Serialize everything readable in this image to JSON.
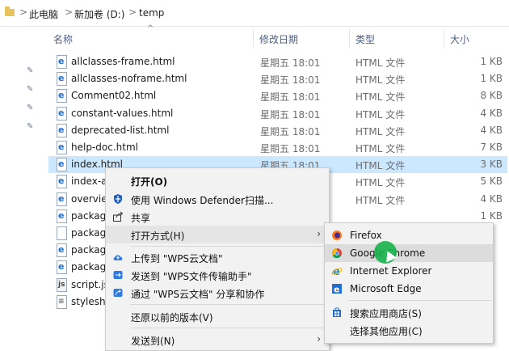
{
  "breadcrumb": {
    "items": [
      "此电脑",
      "新加卷 (D:)",
      "temp"
    ],
    "separator": ">"
  },
  "columns": {
    "name": "名称",
    "date": "修改日期",
    "type": "类型",
    "size": "大小",
    "sort_indicator": "^"
  },
  "files": [
    {
      "name": "allclasses-frame.html",
      "date": "星期五 18:01",
      "type": "HTML 文件",
      "size": "1 KB",
      "icon": "html-file-icon"
    },
    {
      "name": "allclasses-noframe.html",
      "date": "星期五 18:01",
      "type": "HTML 文件",
      "size": "1 KB",
      "icon": "html-file-icon"
    },
    {
      "name": "Comment02.html",
      "date": "星期五 18:01",
      "type": "HTML 文件",
      "size": "8 KB",
      "icon": "html-file-icon"
    },
    {
      "name": "constant-values.html",
      "date": "星期五 18:01",
      "type": "HTML 文件",
      "size": "4 KB",
      "icon": "html-file-icon"
    },
    {
      "name": "deprecated-list.html",
      "date": "星期五 18:01",
      "type": "HTML 文件",
      "size": "4 KB",
      "icon": "html-file-icon"
    },
    {
      "name": "help-doc.html",
      "date": "星期五 18:01",
      "type": "HTML 文件",
      "size": "7 KB",
      "icon": "html-file-icon"
    },
    {
      "name": "index.html",
      "date": "星期五 18:01",
      "type": "HTML 文件",
      "size": "3 KB",
      "icon": "html-file-icon",
      "selected": true
    },
    {
      "name": "index-a",
      "date": "",
      "type": "HTML 文件",
      "size": "5 KB",
      "icon": "html-file-icon"
    },
    {
      "name": "overvie",
      "date": "",
      "type": "HTML 文件",
      "size": "4 KB",
      "icon": "html-file-icon"
    },
    {
      "name": "packag",
      "date": "",
      "type": "",
      "size": "1 KB",
      "icon": "html-file-icon"
    },
    {
      "name": "packag",
      "date": "",
      "type": "",
      "size": "",
      "icon": "blank-file-icon"
    },
    {
      "name": "packag",
      "date": "",
      "type": "",
      "size": "",
      "icon": "html-file-icon"
    },
    {
      "name": "packag",
      "date": "",
      "type": "",
      "size": "",
      "icon": "html-file-icon"
    },
    {
      "name": "script.js",
      "date": "",
      "type": "",
      "size": "",
      "icon": "js-file-icon"
    },
    {
      "name": "styleshe",
      "date": "",
      "type": "",
      "size": "",
      "icon": "css-file-icon"
    }
  ],
  "context_menu": {
    "items": [
      {
        "label": "打开(O)",
        "bold": true,
        "icon": ""
      },
      {
        "label": "使用 Windows Defender扫描...",
        "icon": "defender-shield-icon"
      },
      {
        "label": "共享",
        "icon": "share-icon"
      },
      {
        "label": "打开方式(H)",
        "icon": "",
        "submenu": true
      },
      {
        "label": "上传到 \"WPS云文档\"",
        "icon": "wps-cloud-upload-icon"
      },
      {
        "label": "发送到 \"WPS文件传输助手\"",
        "icon": "wps-transfer-icon"
      },
      {
        "label": "通过 \"WPS云文档\" 分享和协作",
        "icon": "wps-share-icon"
      },
      {
        "label": "还原以前的版本(V)",
        "icon": ""
      },
      {
        "label": "发送到(N)",
        "icon": "",
        "submenu": true
      }
    ]
  },
  "open_with_menu": {
    "items": [
      {
        "label": "Firefox",
        "icon": "firefox-icon"
      },
      {
        "label": "Google Chrome",
        "icon": "chrome-icon",
        "hover": true
      },
      {
        "label": "Internet Explorer",
        "icon": "internet-explorer-icon"
      },
      {
        "label": "Microsoft Edge",
        "icon": "edge-icon"
      },
      {
        "label": "搜索应用商店(S)",
        "icon": "store-icon"
      },
      {
        "label": "选择其他应用(C)",
        "icon": ""
      }
    ]
  },
  "colors": {
    "selected_row": "#cce8ff",
    "menu_bg": "#f2f2f2",
    "header_text": "#4d6082",
    "cursor_highlight": "#17b24b"
  }
}
